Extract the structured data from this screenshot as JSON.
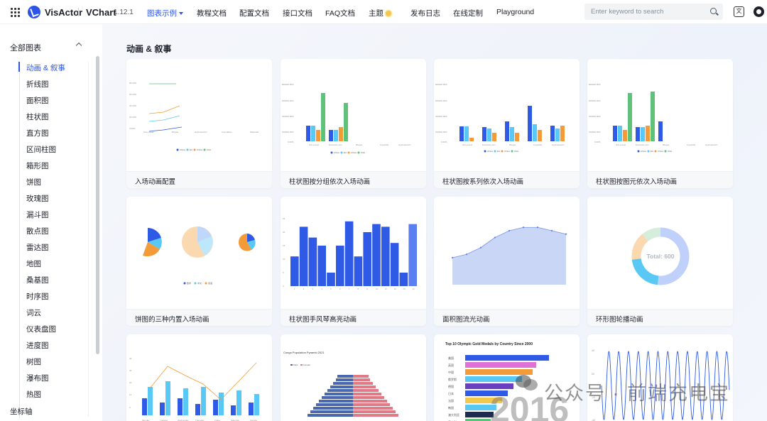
{
  "header": {
    "brand": "VisActor",
    "product": "VChart",
    "version": "1.12.1",
    "nav": [
      {
        "label": "图表示例",
        "active": true
      },
      {
        "label": "教程文档"
      },
      {
        "label": "配置文档"
      },
      {
        "label": "接口文档"
      },
      {
        "label": "FAQ文档"
      },
      {
        "label": "主题"
      },
      {
        "label": "发布日志"
      },
      {
        "label": "在线定制"
      },
      {
        "label": "Playground"
      }
    ],
    "search_placeholder": "Enter keyword to search",
    "icons": [
      "apps-grid-icon",
      "visactor-logo-icon",
      "chevron-down-icon",
      "sun-icon",
      "search-icon",
      "translate-icon",
      "github-icon"
    ]
  },
  "sidebar": {
    "group": "全部图表",
    "items": [
      "动画 & 叙事",
      "折线图",
      "面积图",
      "柱状图",
      "直方图",
      "区间柱图",
      "箱形图",
      "饼图",
      "玫瑰图",
      "漏斗图",
      "散点图",
      "雷达图",
      "地图",
      "桑基图",
      "时序图",
      "词云",
      "仪表盘图",
      "进度图",
      "树图",
      "瀑布图",
      "热图"
    ],
    "active_index": 0,
    "next_group": "坐标轴"
  },
  "main": {
    "section_title": "动画 & 叙事",
    "cards": [
      {
        "caption": "入场动画配置"
      },
      {
        "caption": "柱状图按分组依次入场动画"
      },
      {
        "caption": "柱状图按系列依次入场动画"
      },
      {
        "caption": "柱状图按图元依次入场动画"
      },
      {
        "caption": "饼图的三种内置入场动画"
      },
      {
        "caption": "柱状图手风琴高亮动画"
      },
      {
        "caption": "面积图流光动画"
      },
      {
        "caption": "环形图轮播动画"
      },
      {
        "caption": ""
      },
      {
        "caption": ""
      },
      {
        "caption": ""
      },
      {
        "caption": ""
      }
    ],
    "thumb_text": {
      "pyramid_title": "Congo Population Pyramid 2021",
      "medals_title": "Top 10 Olympic Gold Medals by Country Since 2000",
      "donut_total": "Total: 600",
      "medal_countries": [
        "美国",
        "英国",
        "中国",
        "俄罗斯",
        "德国",
        "日本",
        "法国",
        "韩国",
        "澳大利亚",
        "意大利"
      ]
    }
  },
  "chart_data": [
    {
      "type": "bar",
      "categories": [
        "1",
        "2",
        "3",
        "4",
        "5",
        "6",
        "7",
        "8",
        "9",
        "10",
        "11",
        "12",
        "13",
        "14"
      ],
      "values": [
        11,
        22,
        18,
        15,
        5,
        15,
        24,
        11,
        20,
        23,
        22,
        16,
        5,
        23
      ]
    },
    {
      "type": "area",
      "values": [
        8,
        9,
        11,
        14,
        16,
        17,
        17,
        16,
        15
      ]
    },
    {
      "type": "pie",
      "title": "Total: 600"
    }
  ],
  "watermark": {
    "text": "公众号 · 前端充电宝",
    "year": "2016"
  },
  "colors": {
    "accent": "#2c55e8",
    "blue": "#2f5ae5",
    "cyan": "#5ac8f5",
    "orange": "#f29b38",
    "green": "#5ec27a"
  }
}
